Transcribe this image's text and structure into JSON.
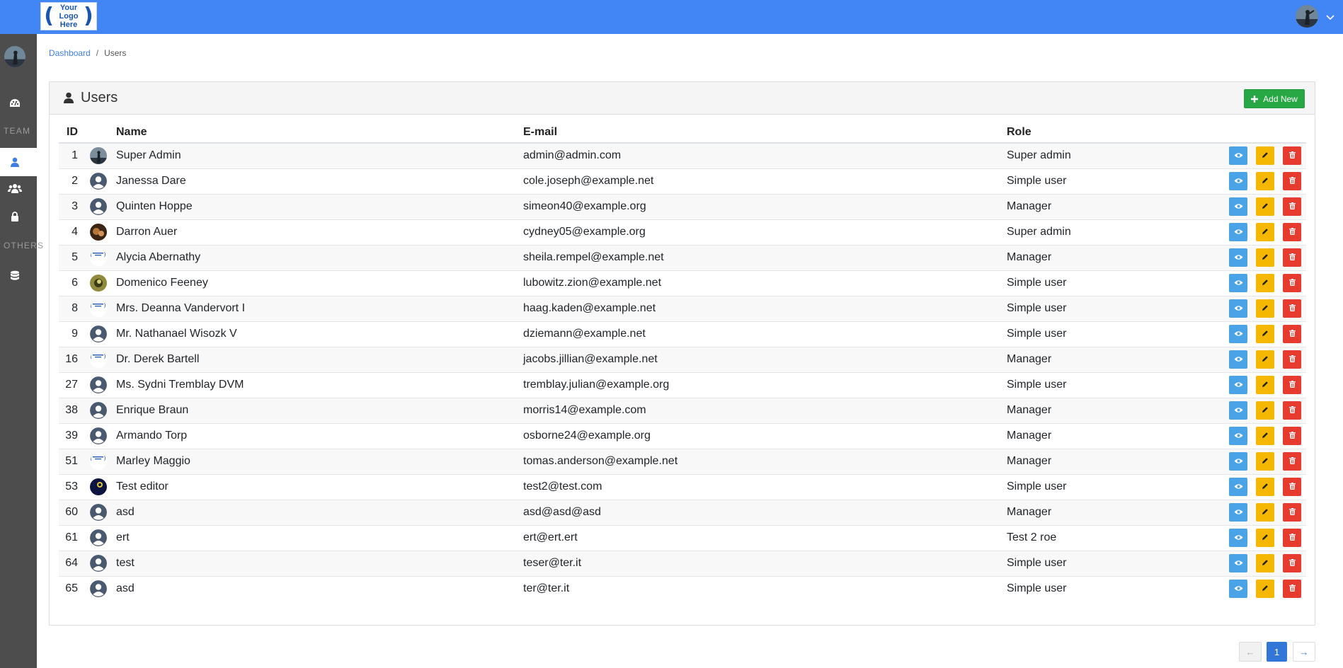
{
  "header": {
    "logo_line1": "Your Logo",
    "logo_line2": "Here",
    "user_avatar": "user-avatar",
    "caret_icon": "chevron-down-icon"
  },
  "sidebar": {
    "items": [
      {
        "name": "dashboard",
        "icon": "palette-icon"
      },
      {
        "name": "users",
        "icon": "user-icon",
        "active": true
      },
      {
        "name": "teams",
        "icon": "users-group-icon"
      },
      {
        "name": "permissions",
        "icon": "lock-icon"
      },
      {
        "name": "database",
        "icon": "database-icon"
      }
    ],
    "team_label": "TEAM",
    "others_label": "OTHERS"
  },
  "breadcrumb": {
    "home": "Dashboard",
    "separator": "/",
    "current": "Users"
  },
  "panel": {
    "title": "Users",
    "add_label": "Add New"
  },
  "table": {
    "columns": [
      "ID",
      "Name",
      "E-mail",
      "Role"
    ],
    "rows": [
      {
        "id": "1",
        "avatar": "photo-dark",
        "name": "Super Admin",
        "email": "admin@admin.com",
        "role": "Super admin"
      },
      {
        "id": "2",
        "avatar": "default",
        "name": "Janessa Dare",
        "email": "cole.joseph@example.net",
        "role": "Simple user"
      },
      {
        "id": "3",
        "avatar": "default",
        "name": "Quinten Hoppe",
        "email": "simeon40@example.org",
        "role": "Manager"
      },
      {
        "id": "4",
        "avatar": "photo-brown",
        "name": "Darron Auer",
        "email": "cydney05@example.org",
        "role": "Super admin"
      },
      {
        "id": "5",
        "avatar": "logo",
        "name": "Alycia Abernathy",
        "email": "sheila.rempel@example.net",
        "role": "Manager"
      },
      {
        "id": "6",
        "avatar": "photo-olive",
        "name": "Domenico Feeney",
        "email": "lubowitz.zion@example.net",
        "role": "Simple user"
      },
      {
        "id": "8",
        "avatar": "logo",
        "name": "Mrs. Deanna Vandervort I",
        "email": "haag.kaden@example.net",
        "role": "Simple user"
      },
      {
        "id": "9",
        "avatar": "default",
        "name": "Mr. Nathanael Wisozk V",
        "email": "dziemann@example.net",
        "role": "Simple user"
      },
      {
        "id": "16",
        "avatar": "logo",
        "name": "Dr. Derek Bartell",
        "email": "jacobs.jillian@example.net",
        "role": "Manager"
      },
      {
        "id": "27",
        "avatar": "default",
        "name": "Ms. Sydni Tremblay DVM",
        "email": "tremblay.julian@example.org",
        "role": "Simple user"
      },
      {
        "id": "38",
        "avatar": "default",
        "name": "Enrique Braun",
        "email": "morris14@example.com",
        "role": "Manager"
      },
      {
        "id": "39",
        "avatar": "default",
        "name": "Armando Torp",
        "email": "osborne24@example.org",
        "role": "Manager"
      },
      {
        "id": "51",
        "avatar": "logo",
        "name": "Marley Maggio",
        "email": "tomas.anderson@example.net",
        "role": "Manager"
      },
      {
        "id": "53",
        "avatar": "photo-navy",
        "name": "Test editor",
        "email": "test2@test.com",
        "role": "Simple user"
      },
      {
        "id": "60",
        "avatar": "default",
        "name": "asd",
        "email": "asd@asd@asd",
        "role": "Manager"
      },
      {
        "id": "61",
        "avatar": "default",
        "name": "ert",
        "email": "ert@ert.ert",
        "role": "Test 2 roe"
      },
      {
        "id": "64",
        "avatar": "default",
        "name": "test",
        "email": "teser@ter.it",
        "role": "Simple user"
      },
      {
        "id": "65",
        "avatar": "default",
        "name": "asd",
        "email": "ter@ter.it",
        "role": "Simple user"
      }
    ],
    "action_icons": [
      "eye-icon",
      "pencil-icon",
      "trash-icon"
    ]
  },
  "pagination": {
    "prev": "←",
    "page": "1",
    "next": "→"
  },
  "colors": {
    "topbar": "#4285f4",
    "sidebar": "#4d4d4d",
    "add": "#28a745",
    "view": "#4aa3e6",
    "edit": "#f5b800",
    "delete": "#e83b30",
    "page_active": "#3277d8"
  }
}
